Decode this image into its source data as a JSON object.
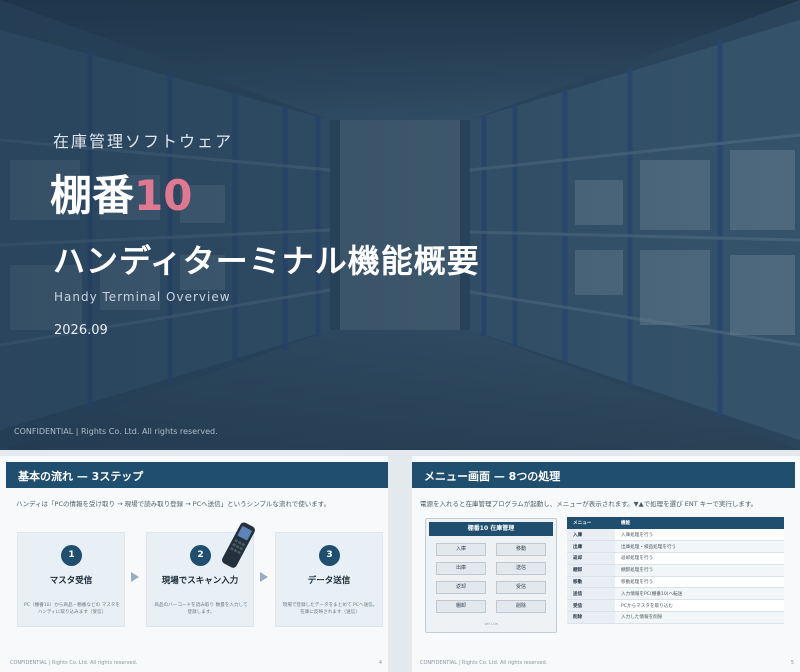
{
  "colors": {
    "navy": "#1f4e6e",
    "accent_pink": "#e0788f",
    "hero_overlay": "#2b465c"
  },
  "hero": {
    "kicker": "在庫管理ソフトウェア",
    "product_name": "棚番",
    "product_version": "10",
    "headline": "ハンディターミナル機能概要",
    "subtitle_en": "Handy Terminal Overview",
    "date": "2026.09",
    "confidential": "CONFIDENTIAL | Rights Co. Ltd. All rights reserved."
  },
  "slide_flow": {
    "header": "基本の流れ — 3ステップ",
    "intro": "ハンディは「PCの情報を受け取り → 現場で読み取り登録 → PCへ送信」というシンプルな流れで使います。",
    "steps": [
      {
        "num": "1",
        "title": "マスタ受信",
        "desc": "PC（棚番10）から商品・棚番などの マスタをハンディに取り込みます（受信）"
      },
      {
        "num": "2",
        "title": "現場でスキャン入力",
        "desc": "商品のバーコードを読み取り 数量を入力して登録します。"
      },
      {
        "num": "3",
        "title": "データ送信",
        "desc": "現場で登録したデータをまとめて PCへ送信。在庫に反映されます（送信）"
      }
    ],
    "icon": "handy-terminal-icon",
    "footer": "CONFIDENTIAL | Rights Co. Ltd. All rights reserved.",
    "page": "4"
  },
  "slide_menu": {
    "header": "メニュー画面 — 8つの処理",
    "intro": "電源を入れると在庫管理プログラムが起動し、メニューが表示されます。▼▲で処理を選び ENT キーで実行します。",
    "device_title": "棚番10 在庫管理",
    "buttons": [
      "入庫",
      "移動",
      "出庫",
      "送信",
      "返却",
      "受信",
      "棚卸",
      "削除"
    ],
    "device_footer": "Ver1.0a",
    "table": {
      "headers": [
        "メニュー",
        "機能"
      ],
      "rows": [
        [
          "入庫",
          "入庫処理を行う"
        ],
        [
          "出庫",
          "出庫処理・検品処理を行う"
        ],
        [
          "返却",
          "返却処理を行う"
        ],
        [
          "棚卸",
          "棚卸処理を行う"
        ],
        [
          "移動",
          "移動処理を行う"
        ],
        [
          "送信",
          "入力情報をPC(棚番10)へ転送"
        ],
        [
          "受信",
          "PCからマスタを取り込む"
        ],
        [
          "削除",
          "入力した情報を削除"
        ]
      ]
    },
    "footer": "CONFIDENTIAL | Rights Co. Ltd. All rights reserved.",
    "page": "5"
  }
}
